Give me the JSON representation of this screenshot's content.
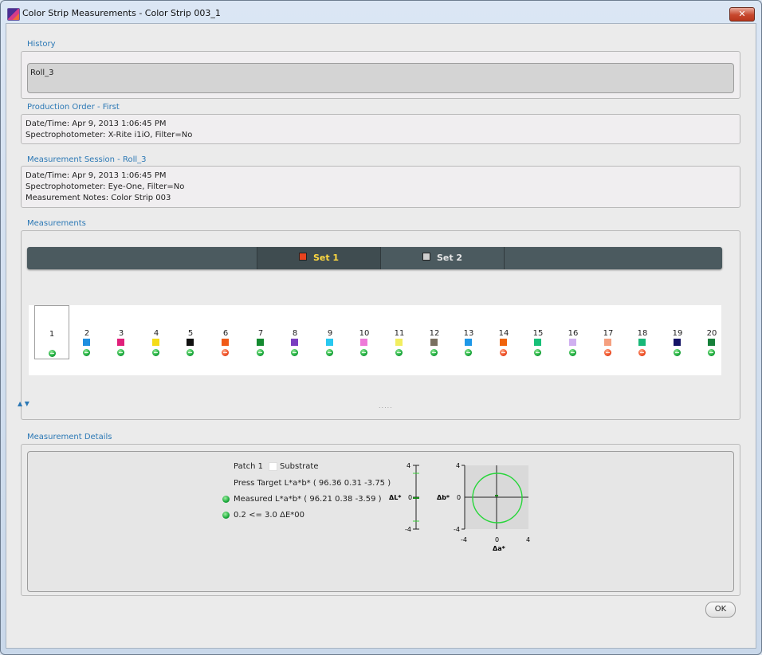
{
  "window": {
    "title": "Color Strip Measurements - Color Strip 003_1",
    "close_label": "✕"
  },
  "history": {
    "label": "History",
    "value": "Roll_3"
  },
  "production_order": {
    "label": "Production Order - First",
    "datetime": "Date/Time:  Apr 9, 2013 1:06:45 PM",
    "spectro": "Spectrophotometer: X-Rite i1iO,   Filter=No"
  },
  "measurement_session": {
    "label": "Measurement Session - Roll_3",
    "datetime": "Date/Time: Apr 9, 2013 1:06:45 PM",
    "spectro": "Spectrophotometer: Eye-One,   Filter=No",
    "notes": "Measurement Notes:  Color Strip 003"
  },
  "measurements": {
    "label": "Measurements",
    "tabs": [
      {
        "label": "Set 1",
        "active": true,
        "swatch": "#e8431f"
      },
      {
        "label": "Set 2",
        "active": false,
        "swatch": "#cfcfcf"
      }
    ],
    "patches": [
      {
        "num": "1",
        "color": "#ffffff",
        "status": "ok"
      },
      {
        "num": "2",
        "color": "#1f8fe0",
        "status": "ok"
      },
      {
        "num": "3",
        "color": "#e0207a",
        "status": "ok"
      },
      {
        "num": "4",
        "color": "#f5dc18",
        "status": "ok"
      },
      {
        "num": "5",
        "color": "#111111",
        "status": "ok"
      },
      {
        "num": "6",
        "color": "#f05a18",
        "status": "bad"
      },
      {
        "num": "7",
        "color": "#148a30",
        "status": "ok"
      },
      {
        "num": "8",
        "color": "#7a3fc0",
        "status": "ok"
      },
      {
        "num": "9",
        "color": "#28c8f0",
        "status": "ok"
      },
      {
        "num": "10",
        "color": "#ee7ad8",
        "status": "ok"
      },
      {
        "num": "11",
        "color": "#f2ee60",
        "status": "ok"
      },
      {
        "num": "12",
        "color": "#7a7060",
        "status": "ok"
      },
      {
        "num": "13",
        "color": "#1e98e8",
        "status": "ok"
      },
      {
        "num": "14",
        "color": "#f0640c",
        "status": "bad"
      },
      {
        "num": "15",
        "color": "#18c078",
        "status": "ok"
      },
      {
        "num": "16",
        "color": "#d0b0f0",
        "status": "ok"
      },
      {
        "num": "17",
        "color": "#f5a080",
        "status": "bad"
      },
      {
        "num": "18",
        "color": "#18b878",
        "status": "bad"
      },
      {
        "num": "19",
        "color": "#141466",
        "status": "ok"
      },
      {
        "num": "20",
        "color": "#16803a",
        "status": "ok"
      }
    ]
  },
  "details": {
    "label": "Measurement Details",
    "patch": "Patch 1",
    "substrate": "Substrate",
    "press_target": "Press Target L*a*b* ( 96.36 0.31 -3.75 )",
    "measured": "Measured L*a*b* ( 96.21 0.38 -3.59 )",
    "delta_e": "0.2 <= 3.0 ΔE*00",
    "dl_chart": {
      "ylabel": "ΔL*",
      "top": "4",
      "mid": "0",
      "bottom": "-4"
    },
    "ab_chart": {
      "ylabel": "Δb*",
      "xlabel": "Δa*",
      "top": "4",
      "mid": "0",
      "bottom": "-4",
      "left": "-4",
      "xmid": "0",
      "right": "4"
    }
  },
  "ok_label": "OK"
}
